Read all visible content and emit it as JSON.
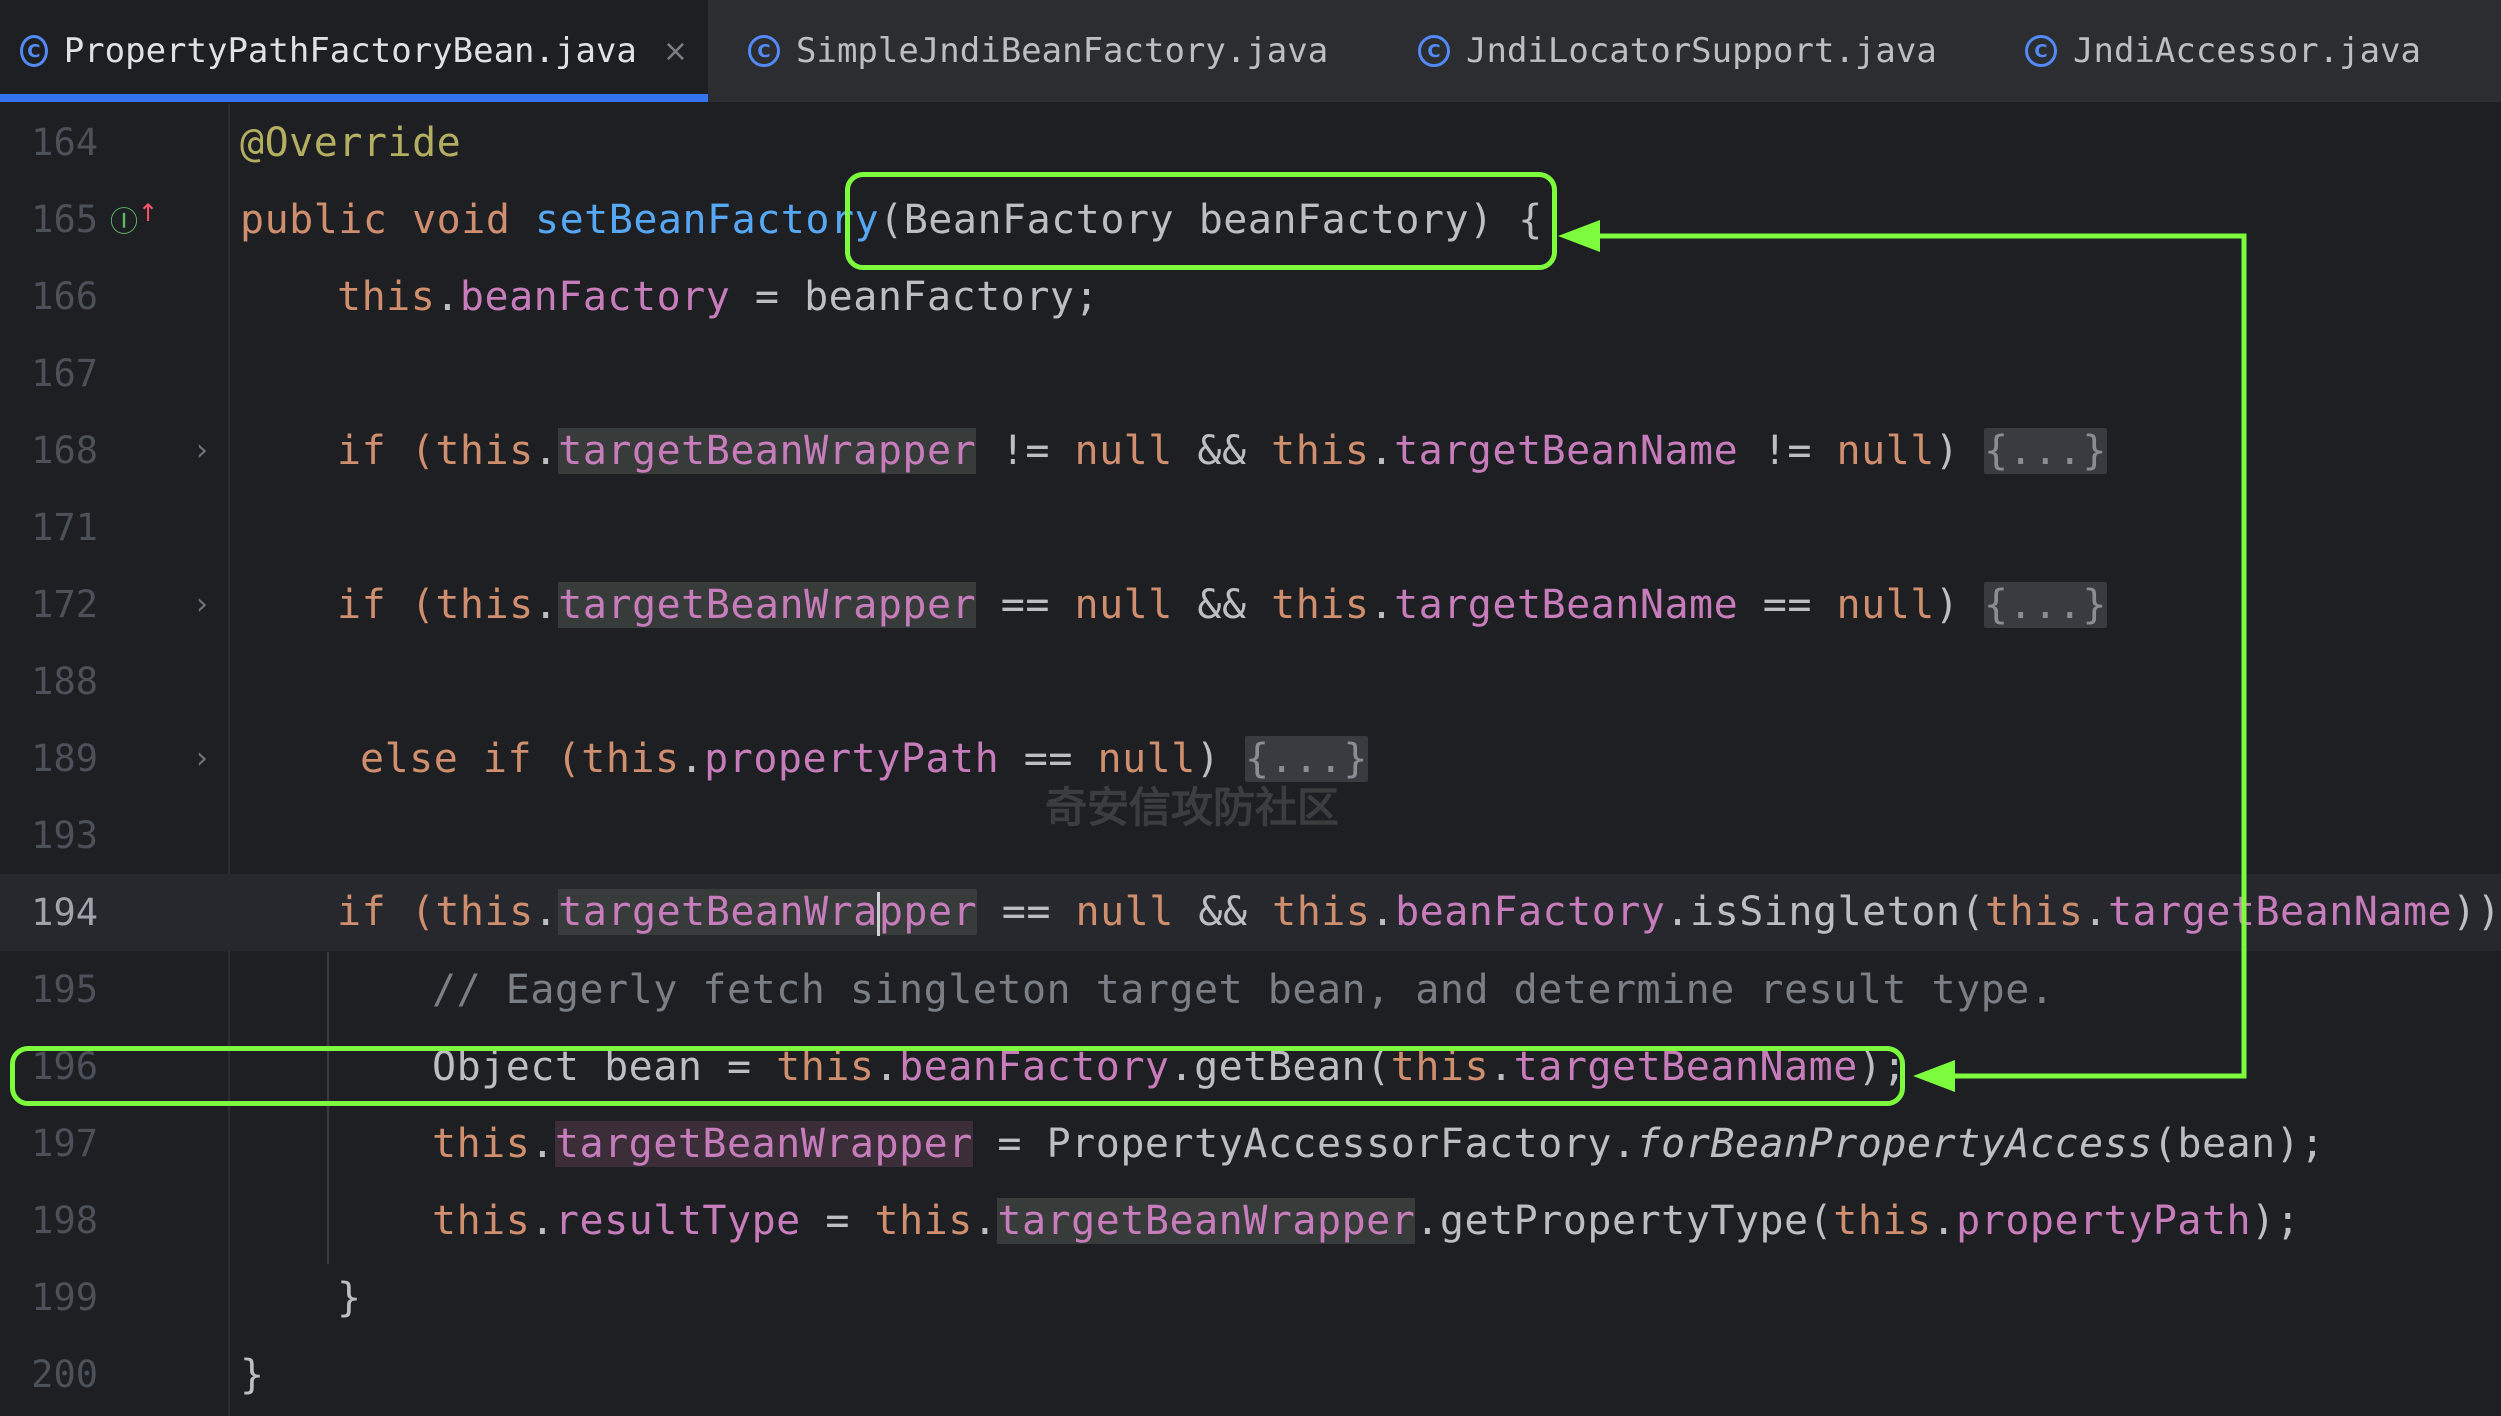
{
  "tabs": [
    {
      "label": "PropertyPathFactoryBean.java",
      "active": true,
      "icon": "class-icon",
      "close": "×"
    },
    {
      "label": "SimpleJndiBeanFactory.java",
      "active": false,
      "icon": "class-icon"
    },
    {
      "label": "JndiLocatorSupport.java",
      "active": false,
      "icon": "class-icon"
    },
    {
      "label": "JndiAccessor.java",
      "active": false,
      "icon": "class-icon"
    }
  ],
  "lines": {
    "l164": "164",
    "l165": "165",
    "l166": "166",
    "l167": "167",
    "l168": "168",
    "l171": "171",
    "l172": "172",
    "l188": "188",
    "l189": "189",
    "l193": "193",
    "l194": "194",
    "l195": "195",
    "l196": "196",
    "l197": "197",
    "l198": "198",
    "l199": "199",
    "l200": "200"
  },
  "code": {
    "c164": "@Override",
    "c165_kw": "public void ",
    "c165_fn": "setBeanFactory",
    "c165_rest": "(BeanFactory beanFactory) {",
    "c166_kw": "this",
    "c166_fld": "beanFactory",
    "c166_rest": " = beanFactory;",
    "c168_if": "if (",
    "c168_this1": "this",
    "c168_f1": "targetBeanWrapper",
    "c168_op1": " != ",
    "c168_null": "null",
    "c168_and": " && ",
    "c168_this2": "this",
    "c168_f2": "targetBeanName",
    "c168_op2": " != ",
    "c168_null2": "null",
    "c168_close": ") ",
    "folded": "{...}",
    "c172_op": " == ",
    "c189_else": "else if (",
    "c189_this": "this",
    "c189_f": "propertyPath",
    "c189_op": " == ",
    "c194_f3": "beanFactory",
    "c194_method": ".isSingleton(",
    "c194_f4a": "targetBe",
    "c194_f4b": "anName",
    "c194_f1a": "targetBeanWra",
    "c194_f1b": "pper",
    "c194_end": ")) {",
    "c195": "// Eagerly fetch singleton target bean, and determine result type.",
    "c196_start": "Object bean = ",
    "c196_method": ".getBean(",
    "c196_end": ");",
    "c197_eq": " = PropertyAccessorFactory.",
    "c197_method": "forBeanPropertyAccess",
    "c197_end": "(bean);",
    "c198_fld": "resultType",
    "c198_eq": " = ",
    "c198_method": ".getPropertyType(",
    "c198_end": ");",
    "close_brace": "}"
  },
  "watermark": "奇安信攻防社区",
  "colors": {
    "callout": "#7cfc3c",
    "accent": "#3574f0"
  }
}
